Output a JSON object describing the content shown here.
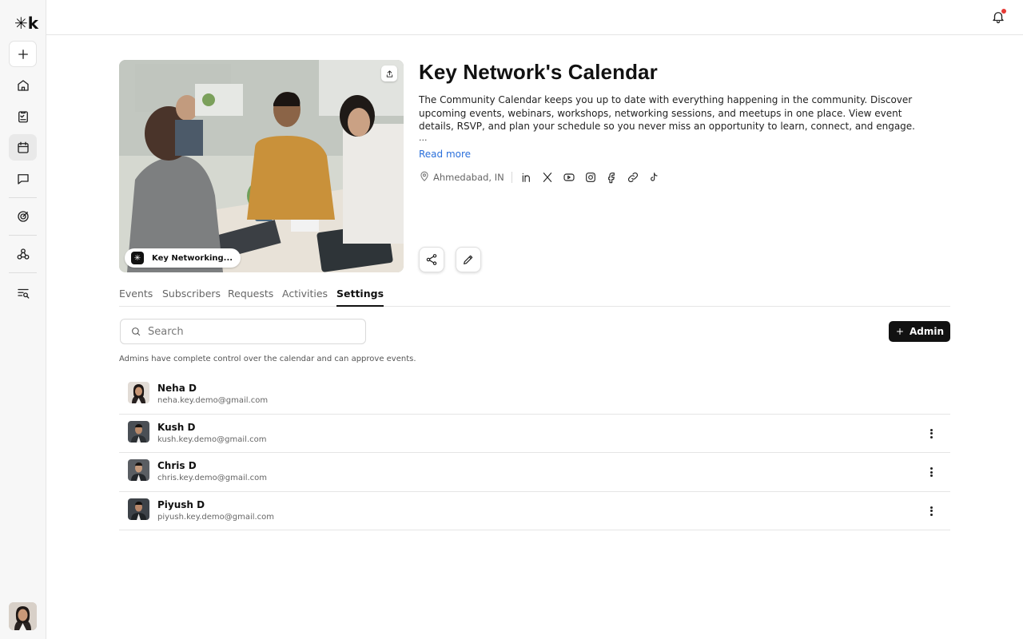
{
  "sidebar": {
    "logo": "✳k",
    "items": [
      {
        "name": "create",
        "icon": "plus-icon"
      },
      {
        "name": "home",
        "icon": "home-icon"
      },
      {
        "name": "tasks",
        "icon": "clipboard-icon"
      },
      {
        "name": "calendar",
        "icon": "calendar-icon",
        "active": true
      },
      {
        "name": "messages",
        "icon": "chat-icon"
      },
      {
        "name": "analytics",
        "icon": "target-icon"
      },
      {
        "name": "integrations",
        "icon": "webhook-icon"
      },
      {
        "name": "search-list",
        "icon": "list-search-icon"
      }
    ]
  },
  "topbar": {
    "notification_icon": "bell-icon",
    "has_unread": true,
    "unread_color": "#e53935"
  },
  "calendar": {
    "title": "Key Network's Calendar",
    "description": "The Community Calendar keeps you up to date with everything happening in the community. Discover upcoming events, webinars, workshops, networking sessions, and meetups in one place. View event details, RSVP, and plan your schedule so you never miss an opportunity to learn, connect, and engage.",
    "ellipsis": "...",
    "read_more": "Read more",
    "location": "Ahmedabad, IN",
    "chip_label": "Key Networking...",
    "socials": [
      "linkedin-icon",
      "x-icon",
      "youtube-icon",
      "instagram-icon",
      "facebook-icon",
      "link-icon",
      "tiktok-icon"
    ]
  },
  "tabs": [
    {
      "label": "Events"
    },
    {
      "label": "Subscribers"
    },
    {
      "label": "Requests"
    },
    {
      "label": "Activities"
    },
    {
      "label": "Settings",
      "active": true
    }
  ],
  "search": {
    "placeholder": "Search",
    "value": ""
  },
  "add_admin_label": "Admin",
  "admin_note": "Admins have complete control over the calendar and can approve events.",
  "admins": [
    {
      "name": "Neha D",
      "email": "neha.key.demo@gmail.com",
      "has_menu": false
    },
    {
      "name": "Kush D",
      "email": "kush.key.demo@gmail.com",
      "has_menu": true
    },
    {
      "name": "Chris D",
      "email": "chris.key.demo@gmail.com",
      "has_menu": true
    },
    {
      "name": "Piyush D",
      "email": "piyush.key.demo@gmail.com",
      "has_menu": true
    }
  ],
  "colors": {
    "accent": "#111111",
    "link": "#2a6fdb",
    "border": "#e5e5e5"
  }
}
